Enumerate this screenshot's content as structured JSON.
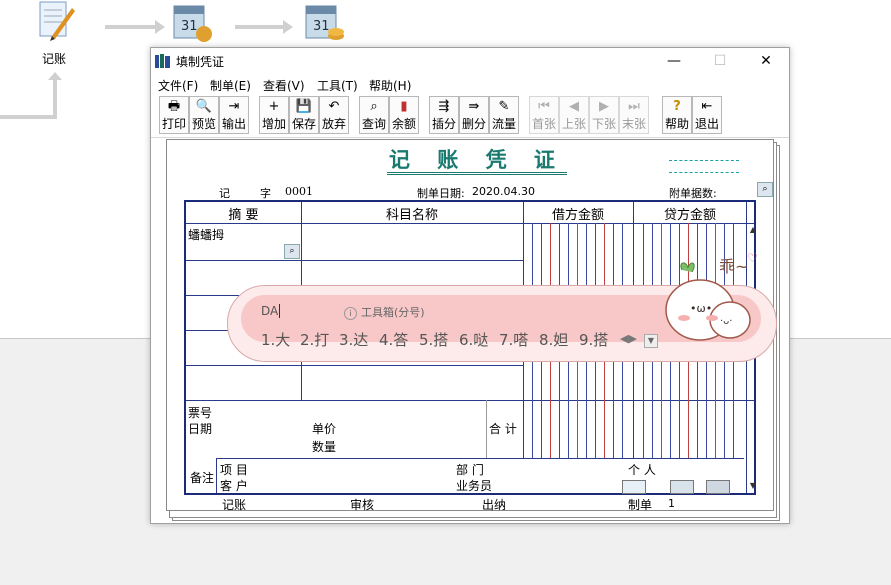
{
  "desktop": {
    "icon1_label": "记账"
  },
  "window": {
    "title": "填制凭证",
    "controls": {
      "minimize": "—",
      "maximize": "☐",
      "close": "✕"
    }
  },
  "menu": [
    "文件(F)",
    "制单(E)",
    "查看(V)",
    "工具(T)",
    "帮助(H)"
  ],
  "toolbar": {
    "buttons": [
      {
        "label": "打印",
        "icon": "printer-icon",
        "glyph": "🖶",
        "enabled": true
      },
      {
        "label": "预览",
        "icon": "preview-icon",
        "glyph": "🔍",
        "enabled": true
      },
      {
        "label": "输出",
        "icon": "export-icon",
        "glyph": "⇥",
        "enabled": true
      },
      {
        "label": "增加",
        "icon": "add-icon",
        "glyph": "+",
        "enabled": true
      },
      {
        "label": "保存",
        "icon": "save-icon",
        "glyph": "💾",
        "enabled": true
      },
      {
        "label": "放弃",
        "icon": "undo-icon",
        "glyph": "↶",
        "enabled": true
      },
      {
        "label": "查询",
        "icon": "binoculars-icon",
        "glyph": "⌕",
        "enabled": true
      },
      {
        "label": "余额",
        "icon": "balance-chart-icon",
        "glyph": "▮",
        "enabled": true
      },
      {
        "label": "插分",
        "icon": "insert-row-icon",
        "glyph": "⇶",
        "enabled": true
      },
      {
        "label": "删分",
        "icon": "delete-row-icon",
        "glyph": "⇛",
        "enabled": true
      },
      {
        "label": "流量",
        "icon": "cashflow-icon",
        "glyph": "✎",
        "enabled": true
      },
      {
        "label": "首张",
        "icon": "first-icon",
        "glyph": "⏮",
        "enabled": false
      },
      {
        "label": "上张",
        "icon": "prev-icon",
        "glyph": "◀",
        "enabled": false
      },
      {
        "label": "下张",
        "icon": "next-icon",
        "glyph": "▶",
        "enabled": false
      },
      {
        "label": "末张",
        "icon": "last-icon",
        "glyph": "⏭",
        "enabled": false
      },
      {
        "label": "帮助",
        "icon": "help-icon",
        "glyph": "?",
        "enabled": true
      },
      {
        "label": "退出",
        "icon": "exit-icon",
        "glyph": "⇤",
        "enabled": true
      }
    ]
  },
  "voucher": {
    "title": "记 账 凭 证",
    "type_label": "记",
    "zi_label": "字",
    "number": "0001",
    "date_label": "制单日期:",
    "date": "2020.04.30",
    "attach_label": "附单据数:",
    "columns": {
      "summary": "摘 要",
      "account": "科目名称",
      "debit": "借方金额",
      "credit": "贷方金额"
    },
    "first_row_summary": "蟠蟠拇",
    "bottom": {
      "ticket_no": "票号",
      "date": "日期",
      "unit_price": "单价",
      "quantity": "数量",
      "total": "合 计",
      "remark": "备注",
      "project": "项  目",
      "customer": "客  户",
      "department": "部  门",
      "salesperson": "业务员",
      "person": "个  人"
    },
    "footer": {
      "bookkeeping": "记账",
      "audit": "审核",
      "cashier": "出纳",
      "maker": "制单",
      "maker_value": "1"
    }
  },
  "ime": {
    "input": "DA",
    "hint": "工具箱(分号)",
    "candidates": [
      "1.大",
      "2.打",
      "3.达",
      "4.答",
      "5.搭",
      "6.哒",
      "7.嗒",
      "8.妲",
      "9.搭"
    ],
    "mascot_text": "乖~"
  }
}
